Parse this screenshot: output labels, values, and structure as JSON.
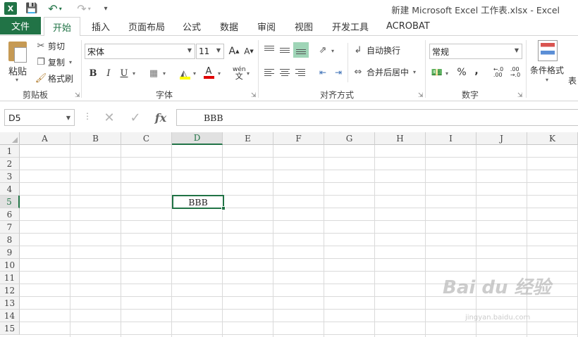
{
  "titlebar": {
    "app_icon": "X",
    "title": "新建 Microsoft Excel 工作表.xlsx - Excel"
  },
  "tabs": {
    "file": "文件",
    "items": [
      "开始",
      "插入",
      "页面布局",
      "公式",
      "数据",
      "审阅",
      "视图",
      "开发工具",
      "ACROBAT"
    ],
    "active": "开始"
  },
  "ribbon": {
    "clipboard": {
      "paste": "粘贴",
      "cut": "剪切",
      "copy": "复制",
      "format_painter": "格式刷",
      "label": "剪贴板"
    },
    "font": {
      "font_name": "宋体",
      "font_size": "11",
      "grow": "A",
      "shrink": "A",
      "bold": "B",
      "italic": "I",
      "underline": "U",
      "font_color_glyph": "A",
      "phonetic": "wén",
      "label": "字体"
    },
    "alignment": {
      "wrap_text": "自动换行",
      "merge_center": "合并后居中",
      "label": "对齐方式"
    },
    "number": {
      "format": "常规",
      "percent": "%",
      "comma": ",",
      "label": "数字"
    },
    "styles": {
      "conditional_format": "条件格式",
      "table_partial": "表"
    }
  },
  "formula_bar": {
    "name_box": "D5",
    "fx": "fx",
    "content": "BBB"
  },
  "grid": {
    "columns": [
      "A",
      "B",
      "C",
      "D",
      "E",
      "F",
      "G",
      "H",
      "I",
      "J",
      "K"
    ],
    "rows": [
      "1",
      "2",
      "3",
      "4",
      "5",
      "6",
      "7",
      "8",
      "9",
      "10",
      "11",
      "12",
      "13",
      "14",
      "15"
    ],
    "selected_column": "D",
    "selected_row": "5",
    "active_cell_value": "BBB"
  },
  "watermark": {
    "text": "Bai du 经验",
    "sub": "jingyan.baidu.com"
  },
  "colors": {
    "excel_green": "#217346"
  }
}
